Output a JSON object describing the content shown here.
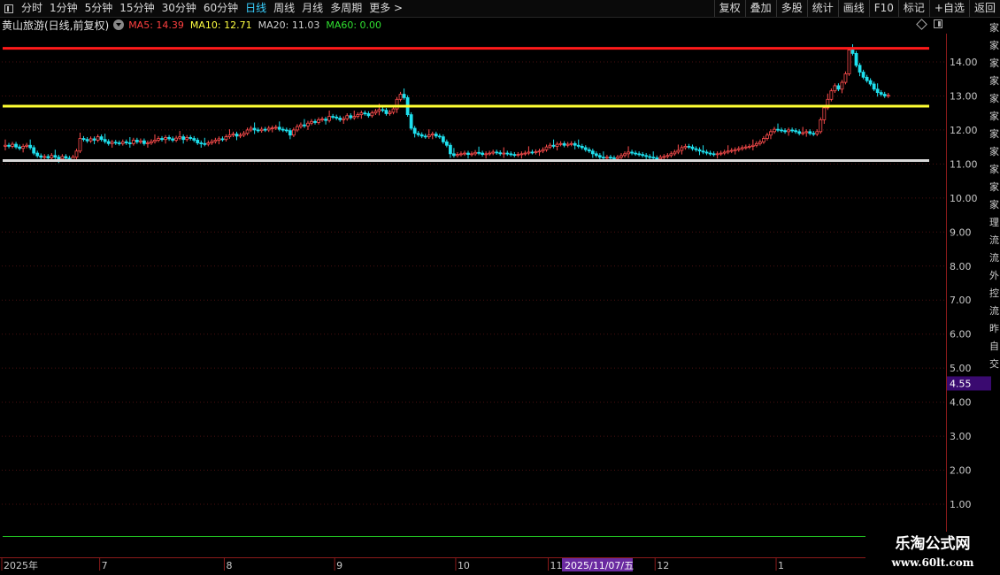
{
  "toolbar": {
    "left": [
      "分时",
      "1分钟",
      "5分钟",
      "15分钟",
      "30分钟",
      "60分钟",
      "日线",
      "周线",
      "月线",
      "多周期",
      "更多 >"
    ],
    "active": "日线",
    "right": [
      "复权",
      "叠加",
      "多股",
      "统计",
      "画线",
      "F10",
      "标记",
      "+自选",
      "返回"
    ]
  },
  "legend": {
    "title": "黄山旅游(日线,前复权)",
    "ma": [
      {
        "label": "MA5: 14.39",
        "color": "#ff4040"
      },
      {
        "label": "MA10: 12.71",
        "color": "#ffff40"
      },
      {
        "label": "MA20: 11.03",
        "color": "#d0d0d0"
      },
      {
        "label": "MA60: 0.00",
        "color": "#30e030"
      }
    ]
  },
  "colors": {
    "up": "#ff4d4d",
    "down": "#1ee0ee",
    "red_line": "#ff1a1a",
    "yellow_line": "#ffff33",
    "gray_line": "#d8d8d8",
    "grid": "#4a1010",
    "axis": "#8a1a1a",
    "label": "#c8c8c8",
    "green_line": "#22c022",
    "date_highlight": "#6a2aa0",
    "price_tag": "#3a0a70"
  },
  "chart_data": {
    "type": "candlestick",
    "ylim": [
      0,
      15.0
    ],
    "y_ticks": [
      "14.00",
      "13.00",
      "12.00",
      "11.00",
      "10.00",
      "9.00",
      "8.00",
      "7.00",
      "6.00",
      "5.00",
      "4.00",
      "3.00",
      "2.00",
      "1.00"
    ],
    "x_labels": [
      "2025年",
      "7",
      "8",
      "9",
      "10",
      "11",
      "12",
      "1"
    ],
    "x_label_index": [
      0,
      27,
      62,
      93,
      127,
      153,
      183,
      217
    ],
    "highlight_date": "2025/11/07/五",
    "price_tag": "4.55",
    "levels": [
      {
        "name": "red",
        "value": 14.4
      },
      {
        "name": "yellow",
        "value": 12.7
      },
      {
        "name": "gray",
        "value": 11.1
      }
    ],
    "num_bars": 260,
    "closes": [
      11.55,
      11.52,
      11.58,
      11.5,
      11.46,
      11.52,
      11.55,
      11.48,
      11.32,
      11.24,
      11.2,
      11.22,
      11.18,
      11.25,
      11.2,
      11.15,
      11.22,
      11.17,
      11.12,
      11.2,
      11.38,
      11.75,
      11.72,
      11.68,
      11.74,
      11.7,
      11.8,
      11.72,
      11.66,
      11.6,
      11.64,
      11.62,
      11.6,
      11.65,
      11.62,
      11.6,
      11.7,
      11.65,
      11.68,
      11.6,
      11.62,
      11.66,
      11.7,
      11.75,
      11.72,
      11.78,
      11.74,
      11.7,
      11.76,
      11.8,
      11.72,
      11.78,
      11.75,
      11.7,
      11.62,
      11.6,
      11.58,
      11.62,
      11.66,
      11.7,
      11.74,
      11.72,
      11.8,
      11.85,
      11.88,
      11.82,
      11.85,
      11.9,
      12.0,
      12.05,
      12.0,
      11.98,
      12.02,
      12.0,
      12.05,
      12.06,
      12.08,
      12.02,
      12.0,
      11.98,
      11.85,
      12.0,
      12.1,
      12.15,
      12.12,
      12.2,
      12.25,
      12.22,
      12.3,
      12.32,
      12.28,
      12.4,
      12.38,
      12.35,
      12.3,
      12.33,
      12.42,
      12.36,
      12.4,
      12.45,
      12.5,
      12.48,
      12.42,
      12.5,
      12.55,
      12.6,
      12.58,
      12.48,
      12.52,
      12.62,
      12.9,
      13.05,
      12.95,
      12.45,
      12.05,
      11.9,
      11.86,
      11.82,
      11.8,
      11.85,
      11.88,
      11.82,
      11.8,
      11.65,
      11.55,
      11.3,
      11.25,
      11.28,
      11.3,
      11.32,
      11.28,
      11.3,
      11.34,
      11.32,
      11.28,
      11.3,
      11.32,
      11.35,
      11.33,
      11.3,
      11.32,
      11.3,
      11.28,
      11.26,
      11.28,
      11.3,
      11.32,
      11.35,
      11.34,
      11.36,
      11.38,
      11.42,
      11.5,
      11.55,
      11.52,
      11.58,
      11.6,
      11.55,
      11.58,
      11.6,
      11.55,
      11.52,
      11.48,
      11.42,
      11.38,
      11.3,
      11.25,
      11.2,
      11.18,
      11.2,
      11.18,
      11.16,
      11.2,
      11.25,
      11.3,
      11.35,
      11.32,
      11.3,
      11.28,
      11.25,
      11.22,
      11.2,
      11.18,
      11.15,
      11.2,
      11.22,
      11.25,
      11.3,
      11.35,
      11.4,
      11.48,
      11.52,
      11.5,
      11.45,
      11.42,
      11.38,
      11.35,
      11.32,
      11.3,
      11.28,
      11.3,
      11.32,
      11.35,
      11.38,
      11.4,
      11.42,
      11.45,
      11.48,
      11.5,
      11.52,
      11.55,
      11.6,
      11.65,
      11.75,
      11.85,
      11.95,
      12.02,
      12.0,
      11.98,
      11.95,
      12.0,
      11.98,
      11.95,
      11.9,
      11.92,
      11.95,
      11.9,
      11.88,
      11.95,
      12.3,
      12.65,
      12.9,
      13.15,
      13.3,
      13.2,
      13.4,
      13.65,
      14.35,
      14.25,
      13.9,
      13.7,
      13.55,
      13.45,
      13.35,
      13.2,
      13.1,
      13.05,
      13.0,
      13.02
    ]
  },
  "watermark": {
    "line1": "乐淘公式网",
    "line2": "www.60lt.com"
  },
  "right_strip": [
    "家",
    "家",
    "家",
    "家",
    "家",
    "家",
    "家",
    "家",
    "家",
    "家",
    "家",
    "理",
    "流",
    "流",
    "外",
    "控",
    "流",
    "昨",
    "自",
    "交"
  ]
}
